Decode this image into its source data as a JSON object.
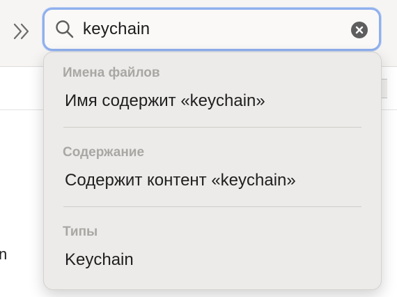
{
  "search": {
    "query": "keychain",
    "search_icon": "magnifying-glass-icon",
    "clear_icon": "clear-x-icon"
  },
  "toolbar": {
    "overflow_icon": "double-chevron-right-icon"
  },
  "background": {
    "left_fragment": "n"
  },
  "suggestions": {
    "sections": [
      {
        "header": "Имена файлов",
        "item": "Имя содержит «keychain»"
      },
      {
        "header": "Содержание",
        "item": "Содержит контент «keychain»"
      },
      {
        "header": "Типы",
        "item": "Keychain"
      }
    ]
  },
  "colors": {
    "focus_ring": "#8fb0ee",
    "dropdown_bg": "#ecebe9",
    "section_header": "#a9a7a4"
  }
}
